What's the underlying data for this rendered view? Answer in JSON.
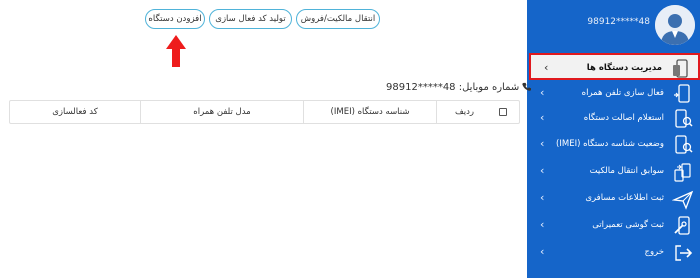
{
  "profile": {
    "phone": "98912*****48"
  },
  "sidebar": {
    "items": [
      {
        "label": "مدیریت دستگاه ها",
        "icon": "device-manage-icon"
      },
      {
        "label": "فعال سازی تلفن همراه",
        "icon": "phone-activate-icon"
      },
      {
        "label": "استعلام اصالت دستگاه",
        "icon": "phone-search-icon"
      },
      {
        "label": "وضعیت شناسه دستگاه (IMEI)",
        "icon": "phone-status-icon"
      },
      {
        "label": "سوابق انتقال مالکیت",
        "icon": "transfer-icon"
      },
      {
        "label": "ثبت اطلاعات مسافری",
        "icon": "plane-icon"
      },
      {
        "label": "ثبت گوشی تعمیراتی",
        "icon": "repair-icon"
      },
      {
        "label": "خروج",
        "icon": "logout-icon"
      }
    ],
    "chevron": "‹"
  },
  "toolbar": {
    "transfer_label": "انتقال مالکیت/فروش",
    "activation_code_label": "تولید کد فعال سازی",
    "add_device_label": "افزودن دستگاه"
  },
  "mobile": {
    "text": "شماره موبایل: 48*****98912"
  },
  "table": {
    "headers": {
      "row": "ردیف",
      "imei": "شناسه دستگاه (IMEI)",
      "model": "مدل تلفن همراه",
      "activation": "کد فعالسازی"
    }
  },
  "colors": {
    "sidebar": "#1565c9",
    "accent_border": "#4fb3d9",
    "highlight": "#e0191e"
  }
}
